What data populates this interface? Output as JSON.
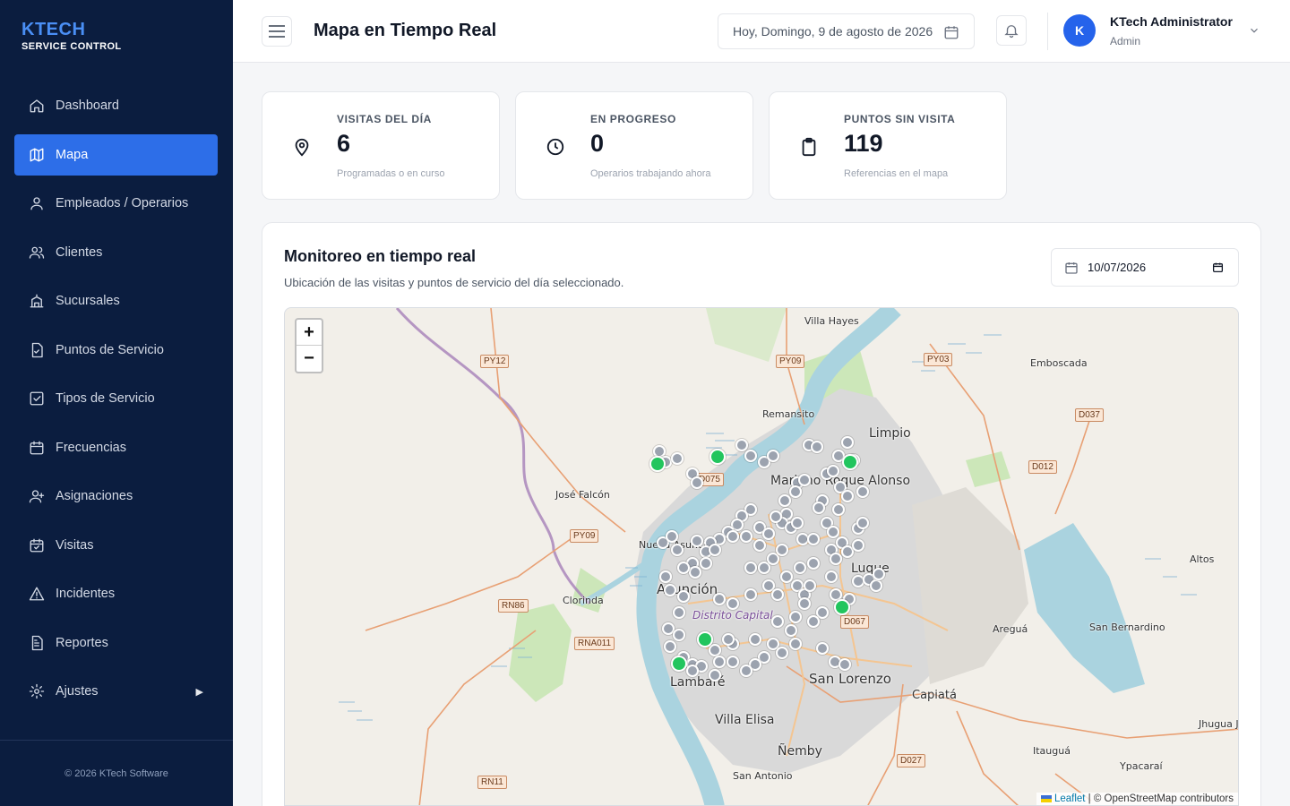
{
  "brand": {
    "title": "KTECH",
    "subtitle": "SERVICE CONTROL"
  },
  "sidebar": {
    "items": [
      {
        "label": "Dashboard",
        "icon": "home-icon"
      },
      {
        "label": "Mapa",
        "icon": "map-icon",
        "active": true
      },
      {
        "label": "Empleados / Operarios",
        "icon": "user-icon"
      },
      {
        "label": "Clientes",
        "icon": "users-icon"
      },
      {
        "label": "Sucursales",
        "icon": "building-icon"
      },
      {
        "label": "Puntos de Servicio",
        "icon": "file-check-icon"
      },
      {
        "label": "Tipos de Servicio",
        "icon": "checkbox-icon"
      },
      {
        "label": "Frecuencias",
        "icon": "calendar-icon"
      },
      {
        "label": "Asignaciones",
        "icon": "user-plus-icon"
      },
      {
        "label": "Visitas",
        "icon": "calendar-check-icon"
      },
      {
        "label": "Incidentes",
        "icon": "warning-icon"
      },
      {
        "label": "Reportes",
        "icon": "report-icon"
      },
      {
        "label": "Ajustes",
        "icon": "settings-icon",
        "arrow": "▶"
      }
    ],
    "footer": "© 2026 KTech Software"
  },
  "header": {
    "title": "Mapa en Tiempo Real",
    "date": "Hoy, Domingo, 9 de agosto de 2026",
    "user_name": "KTech Administrator",
    "user_role": "Admin",
    "avatar_letter": "K"
  },
  "stats": [
    {
      "label": "VISITAS DEL DÍA",
      "value": "6",
      "sub": "Programadas o en curso",
      "icon": "map-pin-icon"
    },
    {
      "label": "EN PROGRESO",
      "value": "0",
      "sub": "Operarios trabajando ahora",
      "icon": "clock-icon"
    },
    {
      "label": "PUNTOS SIN VISITA",
      "value": "119",
      "sub": "Referencias en el mapa",
      "icon": "clipboard-icon"
    }
  ],
  "panel": {
    "title": "Monitoreo en tiempo real",
    "subtitle": "Ubicación de las visitas y puntos de servicio del día seleccionado.",
    "date_value": "10/07/2026"
  },
  "map": {
    "zoom_in": "+",
    "zoom_out": "−",
    "attribution_prefix": "Leaflet",
    "attribution_suffix": " | © OpenStreetMap contributors",
    "places": [
      "Villa Hayes",
      "Emboscada",
      "Remansito",
      "Limpio",
      "José Falcón",
      "Mariano Roque Alonso",
      "Nueva Asunción",
      "Asunción",
      "Clorinda",
      "Luque",
      "Lambaré",
      "San Lorenzo",
      "Capiatá",
      "Villa Elisa",
      "Ñemby",
      "San Antonio",
      "Areguá",
      "San Bernardino",
      "Altos",
      "Itauguá",
      "Ypacaraí",
      "Jhugua Jhu",
      "Distrito Capital"
    ],
    "road_labels": [
      "PY12",
      "PY09",
      "PY03",
      "D037",
      "D012",
      "D075",
      "PY09",
      "RN86",
      "RNA011",
      "D067",
      "D027",
      "RN11"
    ],
    "colors": {
      "visit": "#22c55e",
      "point": "#9ca3af"
    }
  }
}
